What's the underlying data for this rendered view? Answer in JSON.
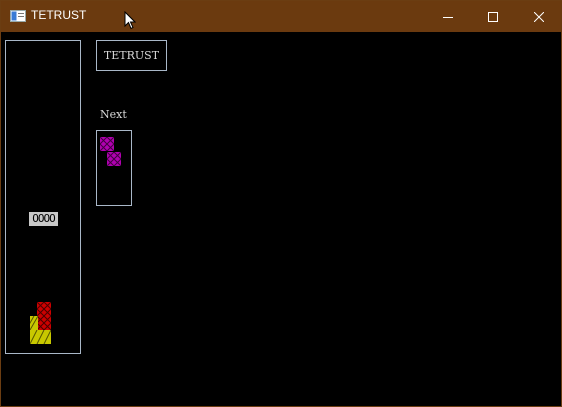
{
  "window": {
    "title": "TETRUST",
    "titlebar_color": "#6b3a0f"
  },
  "game": {
    "title_label": "TETRUST",
    "next_label": "Next",
    "falling_piece_text": "OOOO",
    "colors": {
      "red": "#cc0000",
      "yellow": "#c8c800",
      "magenta": "#b000b0",
      "light_gray": "#c8c8c8"
    }
  },
  "icons": {
    "app": "app-icon",
    "minimize": "minimize-icon",
    "maximize": "maximize-icon",
    "close": "close-icon",
    "cursor": "mouse-cursor-icon"
  }
}
